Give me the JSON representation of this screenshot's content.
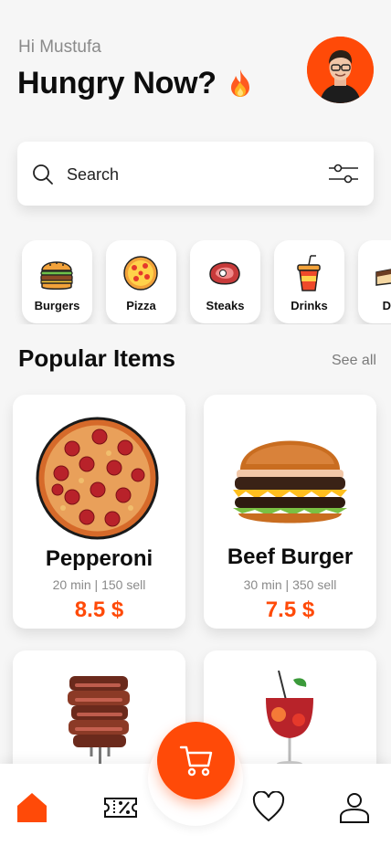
{
  "header": {
    "greeting": "Hi Mustufa",
    "headline": "Hungry Now?",
    "headline_icon": "fire-icon",
    "avatar_icon": "user-avatar"
  },
  "search": {
    "placeholder": "Search",
    "search_icon": "search-icon",
    "filter_icon": "filter-icon"
  },
  "categories": [
    {
      "label": "Burgers",
      "icon": "burger-icon"
    },
    {
      "label": "Pizza",
      "icon": "pizza-icon"
    },
    {
      "label": "Steaks",
      "icon": "steak-icon"
    },
    {
      "label": "Drinks",
      "icon": "drink-icon"
    },
    {
      "label": "Des",
      "icon": "dessert-icon"
    }
  ],
  "popular": {
    "title": "Popular Items",
    "see_all": "See all",
    "items": [
      {
        "name": "Pepperoni",
        "meta": "20 min | 150 sell",
        "price": "8.5 $"
      },
      {
        "name": "Beef Burger",
        "meta": "30 min | 350 sell",
        "price": "7.5 $"
      },
      {
        "name": "",
        "meta": "",
        "price": ""
      },
      {
        "name": "",
        "meta": "",
        "price": ""
      }
    ]
  },
  "nav": {
    "items": [
      "home-icon",
      "coupon-icon",
      "cart-icon",
      "heart-icon",
      "profile-icon"
    ]
  },
  "colors": {
    "accent": "#ff4a08",
    "background": "#f6f6f6",
    "card": "#ffffff",
    "text_muted": "#8a8a8a"
  }
}
